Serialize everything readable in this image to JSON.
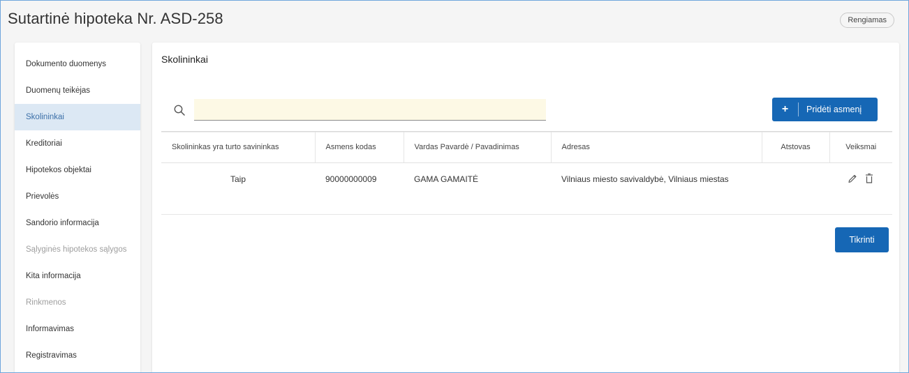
{
  "header": {
    "title": "Sutartinė hipoteka Nr. ASD-258",
    "status": "Rengiamas"
  },
  "sidebar": {
    "items": [
      {
        "label": "Dokumento duomenys",
        "state": "normal"
      },
      {
        "label": "Duomenų teikėjas",
        "state": "normal"
      },
      {
        "label": "Skolininkai",
        "state": "active"
      },
      {
        "label": "Kreditoriai",
        "state": "normal"
      },
      {
        "label": "Hipotekos objektai",
        "state": "normal"
      },
      {
        "label": "Prievolės",
        "state": "normal"
      },
      {
        "label": "Sandorio informacija",
        "state": "normal"
      },
      {
        "label": "Sąlyginės hipotekos sąlygos",
        "state": "disabled"
      },
      {
        "label": "Kita informacija",
        "state": "normal"
      },
      {
        "label": "Rinkmenos",
        "state": "disabled"
      },
      {
        "label": "Informavimas",
        "state": "normal"
      },
      {
        "label": "Registravimas",
        "state": "normal"
      }
    ]
  },
  "main": {
    "section_title": "Skolininkai",
    "search": {
      "value": "",
      "placeholder": "",
      "icon": "search-icon"
    },
    "add_button": {
      "icon": "plus-icon",
      "label": "Pridėti asmenį"
    },
    "table": {
      "columns": [
        "Skolininkas yra turto savininkas",
        "Asmens kodas",
        "Vardas Pavardė / Pavadinimas",
        "Adresas",
        "Atstovas",
        "Veiksmai"
      ],
      "rows": [
        {
          "owner": "Taip",
          "code": "90000000009",
          "name": "GAMA GAMAITĖ",
          "address": "Vilniaus miesto savivaldybė, Vilniaus miestas",
          "representative": "",
          "actions": [
            "edit-icon",
            "delete-icon"
          ]
        }
      ]
    },
    "check_button": {
      "label": "Tikrinti"
    }
  },
  "colors": {
    "accent": "#1667b5",
    "active_item_bg": "#dce8f4",
    "search_bg": "#fdf9e5"
  }
}
